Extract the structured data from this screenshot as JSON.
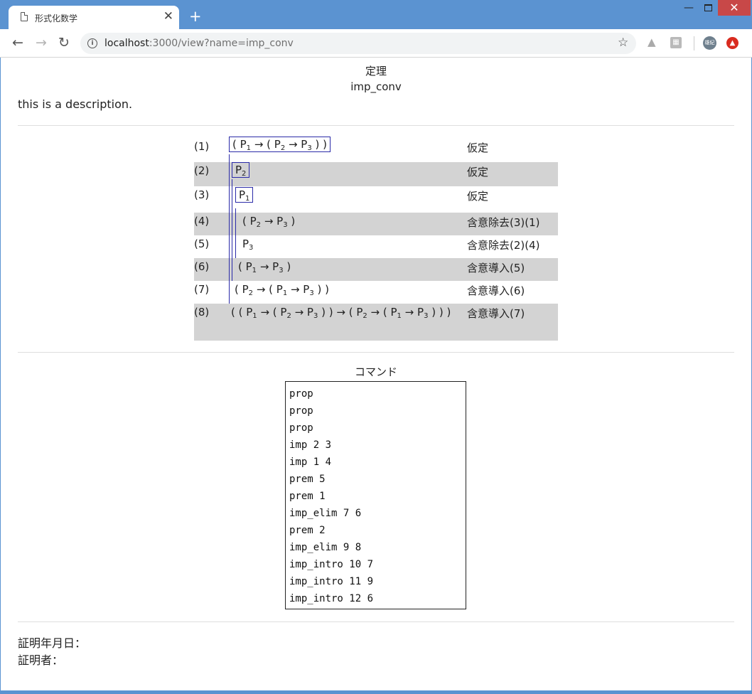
{
  "browser": {
    "tab_title": "形式化数学",
    "tab_close": "✕",
    "new_tab": "+",
    "url_host": "localhost",
    "url_rest": ":3000/view?name=imp_conv",
    "avatar_text": "雄紀",
    "window_min": "—",
    "window_close": "✕"
  },
  "page": {
    "kind": "定理",
    "name": "imp_conv",
    "description": "this is a description."
  },
  "proof": {
    "rows": [
      {
        "num": "(1)",
        "formula": "( P₁ → ( P₂ → P₃ ) )",
        "just": "仮定"
      },
      {
        "num": "(2)",
        "formula": "P₂",
        "just": "仮定"
      },
      {
        "num": "(3)",
        "formula": "P₁",
        "just": "仮定"
      },
      {
        "num": "(4)",
        "formula": "( P₂ → P₃ )",
        "just": "含意除去(3)(1)"
      },
      {
        "num": "(5)",
        "formula": "P₃",
        "just": "含意除去(2)(4)"
      },
      {
        "num": "(6)",
        "formula": "( P₁ → P₃ )",
        "just": "含意導入(5)"
      },
      {
        "num": "(7)",
        "formula": "( P₂ → ( P₁ → P₃ ) )",
        "just": "含意導入(6)"
      },
      {
        "num": "(8)",
        "formula": "( ( P₁ → ( P₂ → P₃ ) ) → ( P₂ → ( P₁ → P₃ ) ) )",
        "just": "含意導入(7)"
      }
    ]
  },
  "commands": {
    "title": "コマンド",
    "lines": [
      "prop",
      "prop",
      "prop",
      "imp 2 3",
      "imp 1 4",
      "prem 5",
      "prem 1",
      "imp_elim 7 6",
      "prem 2",
      "imp_elim 9 8",
      "imp_intro 10 7",
      "imp_intro 11 9",
      "imp_intro 12 6"
    ]
  },
  "footer": {
    "date_label": "証明年月日：",
    "prover_label": "証明者："
  }
}
